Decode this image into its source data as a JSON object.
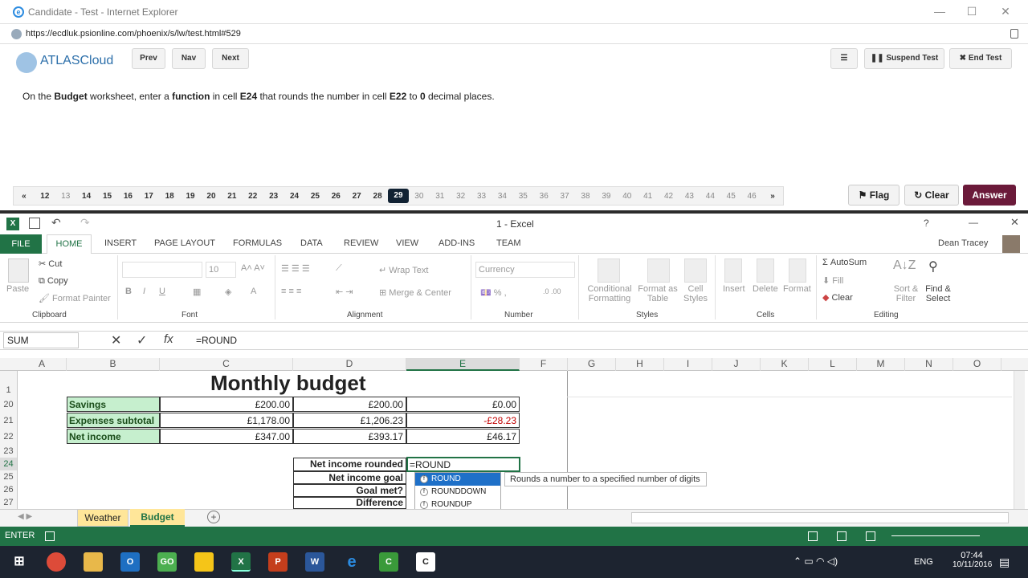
{
  "browser": {
    "title": "Candidate - Test - Internet Explorer",
    "url": "https://ecdluk.psionline.com/phoenix/s/lw/test.html#529"
  },
  "atlas": {
    "logo": "ATLASCloud",
    "prev": "Prev",
    "nav": "Nav",
    "next": "Next",
    "suspend": "Suspend Test",
    "end": "End Test",
    "question_parts": [
      "On the ",
      "Budget",
      " worksheet, enter a ",
      "function",
      " in cell ",
      "E24",
      " that rounds the number in cell ",
      "E22",
      " to ",
      "0",
      " decimal places."
    ],
    "pager": {
      "first": "«",
      "last": "»",
      "items": [
        "12",
        "13",
        "14",
        "15",
        "16",
        "17",
        "18",
        "19",
        "20",
        "21",
        "22",
        "23",
        "24",
        "25",
        "26",
        "27",
        "28",
        "29",
        "30",
        "31",
        "32",
        "33",
        "34",
        "35",
        "36",
        "37",
        "38",
        "39",
        "40",
        "41",
        "42",
        "43",
        "44",
        "45",
        "46"
      ],
      "current": "29"
    },
    "flag": "Flag",
    "clear": "Clear",
    "answer": "Answer"
  },
  "excel": {
    "title": "1 - Excel",
    "user": "Dean Tracey",
    "tabs": [
      "FILE",
      "HOME",
      "INSERT",
      "PAGE LAYOUT",
      "FORMULAS",
      "DATA",
      "REVIEW",
      "VIEW",
      "ADD-INS",
      "TEAM"
    ],
    "clipboard": {
      "paste": "Paste",
      "cut": "Cut",
      "copy": "Copy",
      "painter": "Format Painter",
      "group": "Clipboard"
    },
    "font": {
      "size": "10",
      "group": "Font"
    },
    "alignment": {
      "wrap": "Wrap Text",
      "merge": "Merge & Center",
      "group": "Alignment"
    },
    "number": {
      "format": "Currency",
      "group": "Number"
    },
    "styles": {
      "cond1": "Conditional",
      "cond2": "Formatting",
      "fmt1": "Format as",
      "fmt2": "Table",
      "cell1": "Cell",
      "cell2": "Styles",
      "group": "Styles"
    },
    "cells": {
      "insert": "Insert",
      "delete": "Delete",
      "format": "Format",
      "group": "Cells"
    },
    "editing": {
      "autosum": "AutoSum",
      "fill": "Fill",
      "clear": "Clear",
      "sort1": "Sort &",
      "sort2": "Filter",
      "find1": "Find &",
      "find2": "Select",
      "group": "Editing"
    },
    "namebox": "SUM",
    "formula": "=ROUND",
    "columns": [
      "A",
      "B",
      "C",
      "D",
      "E",
      "F",
      "G",
      "H",
      "I",
      "J",
      "K",
      "L",
      "M",
      "N",
      "O"
    ],
    "title_cell": "Monthly budget",
    "rows": [
      {
        "num": "20",
        "label": "Savings",
        "c": "£200.00",
        "d": "£200.00",
        "e": "£0.00"
      },
      {
        "num": "21",
        "label": "Expenses subtotal",
        "c": "£1,178.00",
        "d": "£1,206.23",
        "e": "-£28.23"
      },
      {
        "num": "22",
        "label": "Net income",
        "c": "£347.00",
        "d": "£393.17",
        "e": "£46.17"
      }
    ],
    "lower_rows": [
      "23",
      "24",
      "25",
      "26",
      "27"
    ],
    "lower_labels": [
      "Net income rounded",
      "Net income goal",
      "Goal met?",
      "Difference"
    ],
    "editing_cell": "=ROUND",
    "autocomplete": [
      "ROUND",
      "ROUNDDOWN",
      "ROUNDUP"
    ],
    "tooltip": "Rounds a number to a specified number of digits",
    "sheets": [
      "Weather",
      "Budget"
    ],
    "status": "ENTER"
  },
  "taskbar": {
    "time": "07:44",
    "date": "10/11/2016",
    "lang": "ENG"
  },
  "colors": {
    "excel_green": "#217346",
    "answer": "#6b1a3a",
    "cell_green": "#c6efce",
    "negative": "#c00000"
  }
}
